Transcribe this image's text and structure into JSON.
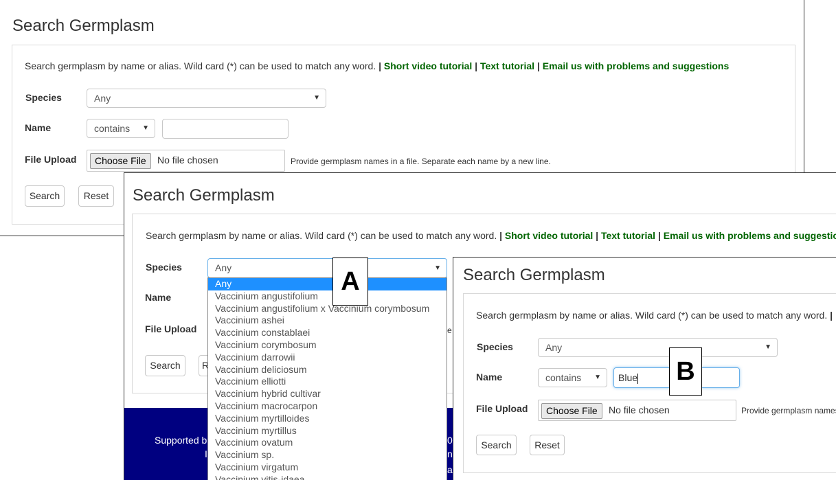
{
  "page_title": "Search Germplasm",
  "description": "Search germplasm by name or alias. Wild card (*) can be used to match any word.",
  "separator": "|",
  "links": {
    "video": "Short video tutorial",
    "text": "Text tutorial",
    "email": "Email us with problems and suggestions",
    "email_truncated": "Email us with problems and suggestio"
  },
  "labels": {
    "species": "Species",
    "name": "Name",
    "file_upload": "File Upload"
  },
  "species_value": "Any",
  "name_operator": "contains",
  "name_value_b": "Blue",
  "file_button": "Choose File",
  "file_status": "No file chosen",
  "file_hint": "Provide germplasm names in a file. Separate each name by a new line.",
  "file_hint_truncated": "Provide germplasm names",
  "buttons": {
    "search": "Search",
    "reset": "Reset",
    "reset_partial": "R"
  },
  "species_options": [
    "Any",
    "Vaccinium angustifolium",
    "Vaccinium angustifolium x Vaccinium corymbosum",
    "Vaccinium ashei",
    "Vaccinium constablaei",
    "Vaccinium corymbosum",
    "Vaccinium darrowii",
    "Vaccinium deliciosum",
    "Vaccinium elliotti",
    "Vaccinium hybrid cultivar",
    "Vaccinium macrocarpon",
    "Vaccinium myrtilloides",
    "Vaccinium myrtillus",
    "Vaccinium ovatum",
    "Vaccinium sp.",
    "Vaccinium virgatum",
    "Vaccinium vitis-idaea"
  ],
  "footer": {
    "supported": "Supported b",
    "frag1": "I",
    "frag2": "0'",
    "frag3": "ne",
    "frag4": "ai"
  },
  "markers": {
    "a": "A",
    "b": "B"
  },
  "colors": {
    "link": "#006400",
    "footer": "#000080",
    "selected": "#1e90ff"
  }
}
